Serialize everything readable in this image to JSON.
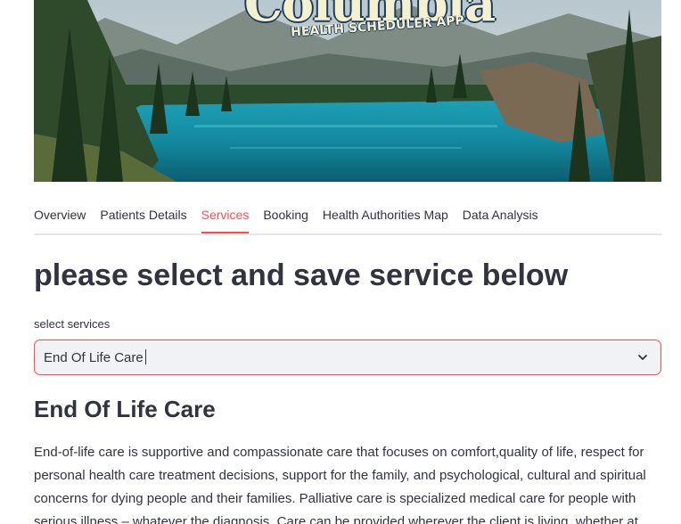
{
  "banner": {
    "title": "Columbia",
    "subtitle": "HEALTH SCHEDULER APP"
  },
  "tabs": [
    {
      "label": "Overview"
    },
    {
      "label": "Patients Details"
    },
    {
      "label": "Services",
      "active": true
    },
    {
      "label": "Booking"
    },
    {
      "label": "Health Authorities Map"
    },
    {
      "label": "Data Analysis"
    }
  ],
  "main": {
    "heading": "please select and save service below",
    "select_label": "select services",
    "select_value": "End Of Life Care",
    "section_heading": "End Of Life Care",
    "description": "End-of-life care is supportive and compassionate care that focuses on comfort,quality of life, respect for personal health care treatment decisions, support for the family, and psychological, cultural and spiritual concerns for dying people and their families. Palliative care is specialized medical care for people with serious illness – whatever the diagnosis. Care can be provided wherever the client is living, whether at"
  },
  "colors": {
    "accent": "#ff4b4b",
    "text": "#31333f",
    "input_bg": "#f0f2f6"
  },
  "icons": {
    "select": "chevron-down-icon"
  }
}
